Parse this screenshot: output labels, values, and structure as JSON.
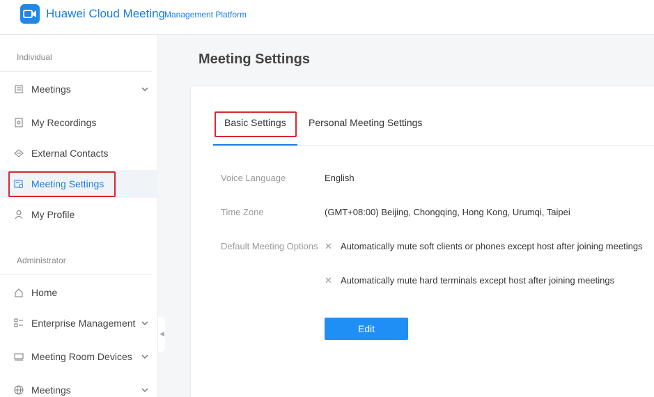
{
  "header": {
    "brand": "Huawei Cloud Meeting",
    "subtitle": "Management Platform",
    "accent": "#1a7ee0"
  },
  "sidebar": {
    "individual_label": "Individual",
    "administrator_label": "Administrator",
    "individual_items": [
      {
        "label": "Meetings",
        "icon": "calendar-icon",
        "expandable": true
      },
      {
        "label": "My Recordings",
        "icon": "recording-icon",
        "expandable": false
      },
      {
        "label": "External Contacts",
        "icon": "contacts-icon",
        "expandable": false
      },
      {
        "label": "Meeting Settings",
        "icon": "settings-calendar-icon",
        "expandable": false,
        "active": true
      },
      {
        "label": "My Profile",
        "icon": "user-icon",
        "expandable": false
      }
    ],
    "admin_items": [
      {
        "label": "Home",
        "icon": "home-icon",
        "expandable": false
      },
      {
        "label": "Enterprise Management",
        "icon": "enterprise-icon",
        "expandable": true
      },
      {
        "label": "Meeting Room Devices",
        "icon": "device-icon",
        "expandable": true
      },
      {
        "label": "Meetings",
        "icon": "globe-icon",
        "expandable": true
      }
    ]
  },
  "main": {
    "title": "Meeting Settings",
    "tabs": [
      {
        "label": "Basic Settings",
        "active": true
      },
      {
        "label": "Personal Meeting Settings",
        "active": false
      }
    ],
    "fields": {
      "voice_language_label": "Voice Language",
      "voice_language_value": "English",
      "time_zone_label": "Time Zone",
      "time_zone_value": "(GMT+08:00) Beijing, Chongqing, Hong Kong, Urumqi, Taipei",
      "default_options_label": "Default Meeting Options",
      "options": [
        {
          "mark": "✕",
          "text": "Automatically mute soft clients or phones except host after joining meetings"
        },
        {
          "mark": "✕",
          "text": "Automatically mute hard terminals except host after joining meetings"
        }
      ]
    },
    "edit_label": "Edit"
  }
}
